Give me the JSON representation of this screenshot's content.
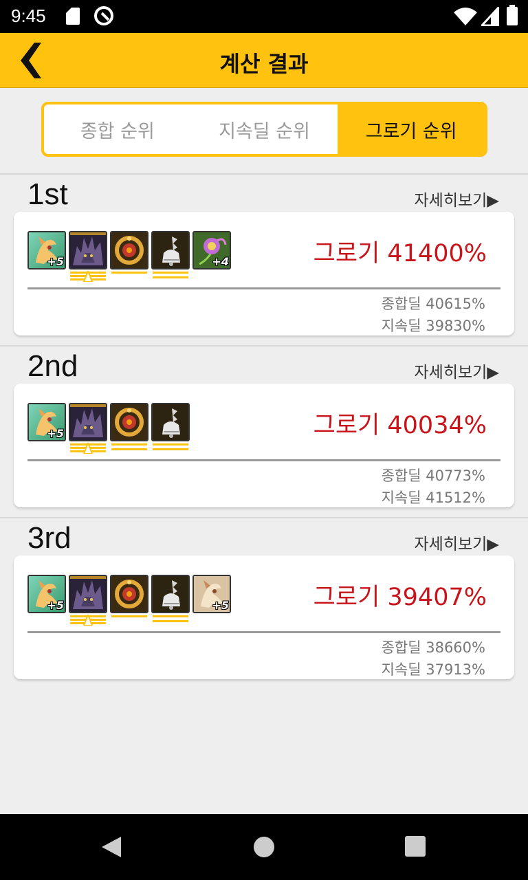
{
  "status_bar": {
    "time": "9:45"
  },
  "app_bar": {
    "title": "계산 결과"
  },
  "tabs": [
    {
      "label": "종합 순위",
      "active": false
    },
    {
      "label": "지속딜 순위",
      "active": false
    },
    {
      "label": "그로기 순위",
      "active": true
    }
  ],
  "colors": {
    "accent": "#ffc20e",
    "value_red": "#c8151b"
  },
  "results": [
    {
      "rank": "1st",
      "detail_link": "자세히보기▶",
      "items": [
        {
          "icon": "fox-spirit-icon",
          "enhance": "+5",
          "underline": ""
        },
        {
          "icon": "dark-beast-icon",
          "enhance": "",
          "underline": "triple-arrow"
        },
        {
          "icon": "gold-gem-ring-icon",
          "enhance": "",
          "underline": "single"
        },
        {
          "icon": "silver-bell-icon",
          "enhance": "",
          "underline": "double"
        },
        {
          "icon": "purple-flower-icon",
          "enhance": "+4",
          "underline": ""
        }
      ],
      "grog": "그로기 41400%",
      "total": "종합딜 40615%",
      "sustain": "지속딜 39830%"
    },
    {
      "rank": "2nd",
      "detail_link": "자세히보기▶",
      "items": [
        {
          "icon": "fox-spirit-icon",
          "enhance": "+5",
          "underline": ""
        },
        {
          "icon": "dark-beast-icon",
          "enhance": "",
          "underline": "triple-arrow"
        },
        {
          "icon": "gold-gem-ring-icon",
          "enhance": "",
          "underline": "double"
        },
        {
          "icon": "silver-bell-icon",
          "enhance": "",
          "underline": "double"
        }
      ],
      "grog": "그로기 40034%",
      "total": "종합딜 40773%",
      "sustain": "지속딜 41512%"
    },
    {
      "rank": "3rd",
      "detail_link": "자세히보기▶",
      "items": [
        {
          "icon": "fox-spirit-icon",
          "enhance": "+5",
          "underline": ""
        },
        {
          "icon": "dark-beast-icon",
          "enhance": "",
          "underline": "triple-arrow"
        },
        {
          "icon": "gold-gem-ring-icon",
          "enhance": "",
          "underline": "single"
        },
        {
          "icon": "silver-bell-icon",
          "enhance": "",
          "underline": "double"
        },
        {
          "icon": "fox-spirit-pale-icon",
          "enhance": "+5",
          "underline": ""
        }
      ],
      "grog": "그로기 39407%",
      "total": "종합딜 38660%",
      "sustain": "지속딜 37913%"
    }
  ]
}
